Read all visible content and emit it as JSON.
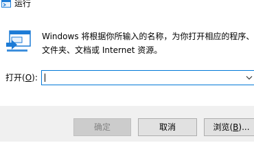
{
  "window": {
    "title": "运行",
    "icon": "run-app-icon"
  },
  "description": {
    "line1": "Windows 将根据你所输入的名称，为你打开相应的程序、",
    "line2": "文件夹、文档或 Internet 资源。"
  },
  "open_field": {
    "label_prefix": "打开(",
    "label_accel": "O",
    "label_suffix": "):",
    "value": "",
    "dropdown_icon": "chevron-down-icon"
  },
  "buttons": {
    "ok_label": "确定",
    "cancel_label": "取消",
    "browse_label_prefix": "浏览(",
    "browse_label_accel": "B",
    "browse_label_suffix": ")..."
  },
  "colors": {
    "focus_border": "#0078d7",
    "icon_blue": "#1c7bd6",
    "footer_bg": "#f0f0f0",
    "disabled_text": "#838383"
  }
}
